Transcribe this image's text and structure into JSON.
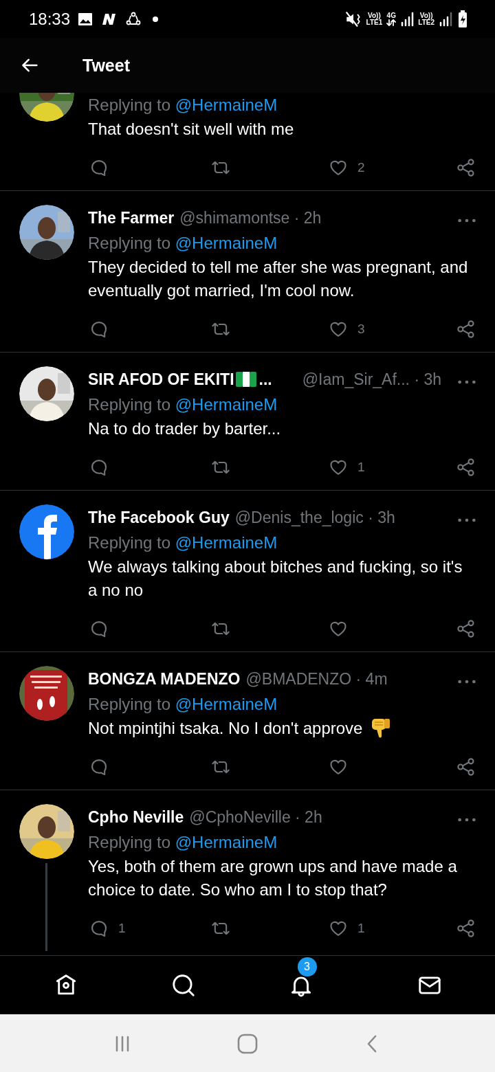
{
  "status_bar": {
    "time": "18:33",
    "sim1": {
      "top": "Vo))",
      "bottom": "LTE1"
    },
    "data": "4G",
    "sim2": {
      "top": "Vo))",
      "bottom": "LTE2"
    }
  },
  "header": {
    "title": "Tweet"
  },
  "tweets": [
    {
      "kind": "partial",
      "replying_label": "Replying to",
      "replying_to": "@HermaineM",
      "text": "That doesn't sit well with me",
      "like_count": "2",
      "thread": false
    },
    {
      "kind": "full",
      "name": "The Farmer",
      "meta": "@shimamontse · 2h",
      "replying_label": "Replying to",
      "replying_to": "@HermaineM",
      "text": "They decided to tell me after she was pregnant, and eventually got married, I'm cool now.",
      "like_count": "3",
      "thread": false
    },
    {
      "kind": "full",
      "name": "SIR AFOD OF EKITI",
      "name_emoji": {
        "kind": "flag"
      },
      "name_suffix": "...",
      "meta": "@Iam_Sir_Af... · 3h",
      "replying_label": "Replying to",
      "replying_to": "@HermaineM",
      "text": "Na to do trader by barter...",
      "like_count": "1",
      "thread": false
    },
    {
      "kind": "full",
      "avatar": {
        "kind": "logo"
      },
      "name": "The Facebook Guy",
      "meta": "@Denis_the_logic · 3h",
      "replying_label": "Replying to",
      "replying_to": "@HermaineM",
      "text": "We always talking about bitches and fucking, so it's a no no",
      "thread": false
    },
    {
      "kind": "full",
      "avatar": {
        "kind": "sign"
      },
      "name": "BONGZA MADENZO",
      "meta": "@BMADENZO · 4m",
      "replying_label": "Replying to",
      "replying_to": "@HermaineM",
      "text": "Not mpintjhi tsaka. No I don't approve",
      "text_emoji": {
        "kind": "thumbs_down"
      },
      "thread": false
    },
    {
      "kind": "full",
      "name": "Cpho Neville",
      "meta": "@CphoNeville · 2h",
      "replying_label": "Replying to",
      "replying_to": "@HermaineM",
      "text": "Yes, both of them are grown ups and have made a choice to date. So who am I to stop that?",
      "reply_count": "1",
      "like_count": "1",
      "thread": true
    }
  ],
  "bottom_nav": {
    "notification_badge": "3"
  }
}
